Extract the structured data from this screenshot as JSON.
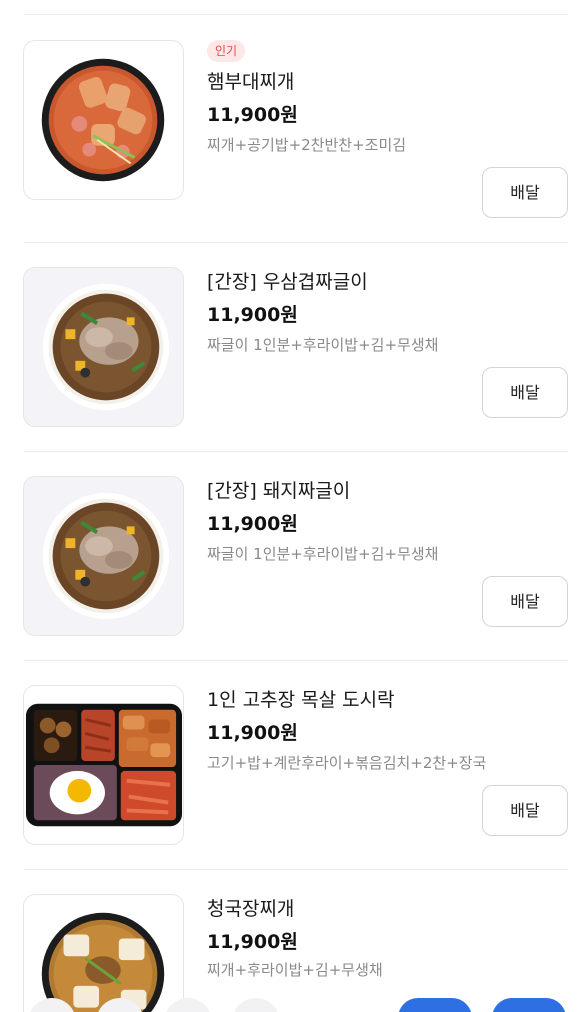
{
  "menu": {
    "items": [
      {
        "badge": "인기",
        "name": "햄부대찌개",
        "price": "11,900원",
        "description": "찌개+공기밥+2찬반찬+조미김",
        "button": "배달",
        "image_icon": "stew-bowl-icon"
      },
      {
        "name": "[간장] 우삼겹짜글이",
        "price": "11,900원",
        "description": "짜글이 1인분+후라이밥+김+무생채",
        "button": "배달",
        "image_icon": "rice-bowl-icon"
      },
      {
        "name": "[간장] 돼지짜글이",
        "price": "11,900원",
        "description": "짜글이 1인분+후라이밥+김+무생채",
        "button": "배달",
        "image_icon": "rice-bowl-icon"
      },
      {
        "name": "1인 고추장 목살 도시락",
        "price": "11,900원",
        "description": "고기+밥+계란후라이+볶음김치+2찬+장국",
        "button": "배달",
        "image_icon": "lunchbox-icon"
      },
      {
        "name": "청국장찌개",
        "price": "11,900원",
        "description": "찌개+후라이밥+김+무생채",
        "image_icon": "stew-bowl-icon"
      }
    ]
  },
  "colors": {
    "badge_bg": "#fde8e8",
    "badge_text": "#e14b4b",
    "accent_blue": "#2f6fe4",
    "description": "#8a8a8a"
  }
}
